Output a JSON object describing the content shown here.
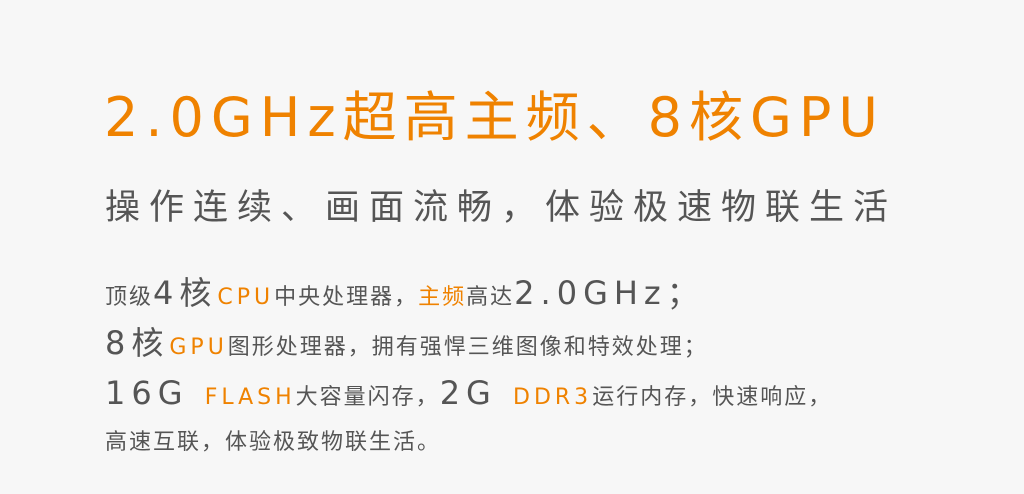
{
  "headline": "2.0GHz超高主频、8核GPU",
  "subtitle": "操作连续、画面流畅，体验极速物联生活",
  "specs": {
    "line1": {
      "a": "顶级",
      "b": "4核",
      "c": "CPU",
      "d": "中央处理器，",
      "e": "主频",
      "f": "高达",
      "g": "2.0GHz；"
    },
    "line2": {
      "a": "8核",
      "b": "GPU",
      "c": "图形处理器，拥有强悍三维图像和特效处理；"
    },
    "line3": {
      "a": "16G ",
      "b": "FLASH",
      "c": "大容量闪存，",
      "d": "2G ",
      "e": "DDR3",
      "f": "运行内存，快速响应，"
    },
    "line4": {
      "a": "高速互联，体验极致物联生活。"
    }
  },
  "colors": {
    "accent": "#ef8200",
    "text": "#555555",
    "background": "#f7f7f7"
  }
}
